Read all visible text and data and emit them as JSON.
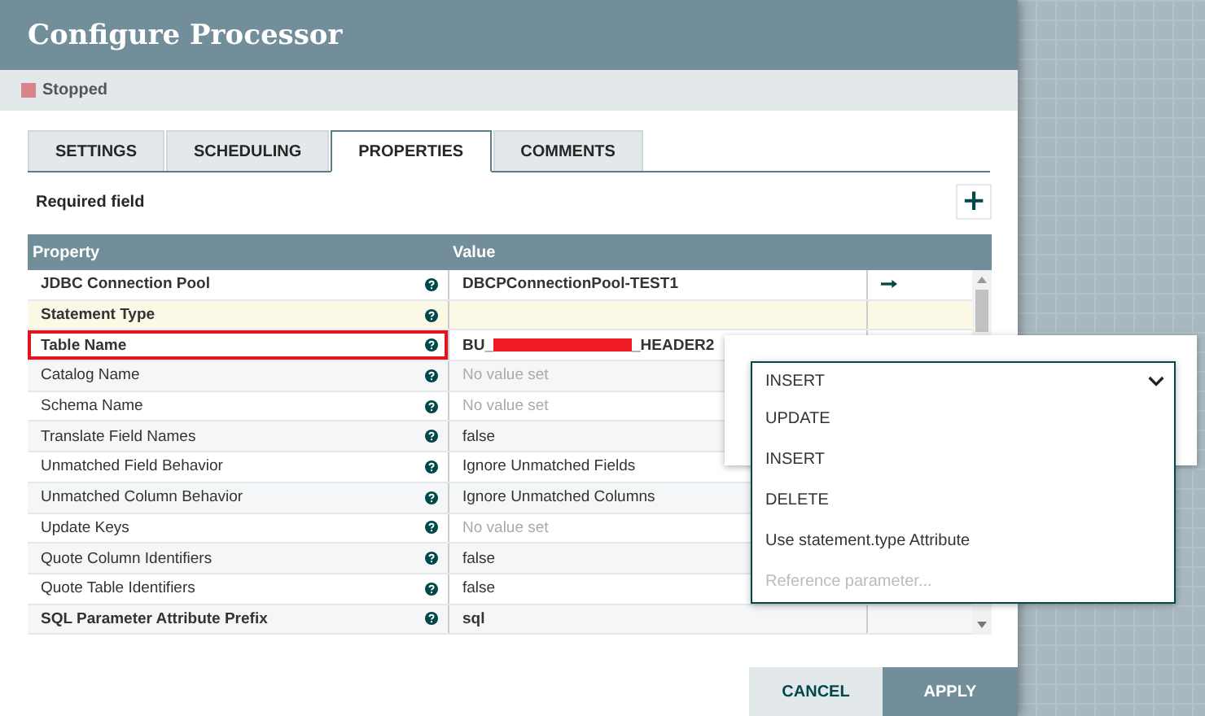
{
  "dialog": {
    "title": "Configure Processor",
    "status": {
      "label": "Stopped",
      "color": "#d9848c"
    }
  },
  "tabs": [
    {
      "label": "SETTINGS",
      "selected": false
    },
    {
      "label": "SCHEDULING",
      "selected": false
    },
    {
      "label": "PROPERTIES",
      "selected": true
    },
    {
      "label": "COMMENTS",
      "selected": false
    }
  ],
  "required_note": "Required field",
  "add_button": "+",
  "table": {
    "columns": [
      "Property",
      "Value"
    ],
    "rows": [
      {
        "property": "JDBC Connection Pool",
        "required": true,
        "selected": false,
        "highlighted": false,
        "value": "DBCPConnectionPool-TEST1",
        "link": true
      },
      {
        "property": "Statement Type",
        "required": true,
        "selected": true,
        "highlighted": false
      },
      {
        "property": "Table Name",
        "required": true,
        "selected": false,
        "highlighted": true,
        "value": "BU_",
        "value_suffix": "_HEADER2",
        "redacted": true
      },
      {
        "property": "Catalog Name",
        "required": false,
        "selected": false,
        "highlighted": false,
        "placeholder": "No value set"
      },
      {
        "property": "Schema Name",
        "required": false,
        "selected": false,
        "highlighted": false,
        "placeholder": "No value set"
      },
      {
        "property": "Translate Field Names",
        "required": false,
        "selected": false,
        "highlighted": false,
        "value": "false"
      },
      {
        "property": "Unmatched Field Behavior",
        "required": false,
        "selected": false,
        "highlighted": false,
        "value": "Ignore Unmatched Fields"
      },
      {
        "property": "Unmatched Column Behavior",
        "required": false,
        "selected": false,
        "highlighted": false,
        "value": "Ignore Unmatched Columns"
      },
      {
        "property": "Update Keys",
        "required": false,
        "selected": false,
        "highlighted": false,
        "placeholder": "No value set"
      },
      {
        "property": "Quote Column Identifiers",
        "required": false,
        "selected": false,
        "highlighted": false,
        "value": "false"
      },
      {
        "property": "Quote Table Identifiers",
        "required": false,
        "selected": false,
        "highlighted": false,
        "value": "false"
      },
      {
        "property": "SQL Parameter Attribute Prefix",
        "required": true,
        "selected": false,
        "highlighted": false,
        "value": "sql"
      }
    ]
  },
  "dropdown": {
    "value": "INSERT",
    "options": [
      {
        "label": "UPDATE",
        "disabled": false
      },
      {
        "label": "INSERT",
        "disabled": false
      },
      {
        "label": "DELETE",
        "disabled": false
      },
      {
        "label": "Use statement.type Attribute",
        "disabled": false
      },
      {
        "label": "Reference parameter...",
        "disabled": true
      }
    ]
  },
  "buttons": [
    {
      "label": "CANCEL",
      "kind": "secondary"
    },
    {
      "label": "APPLY",
      "kind": "primary"
    }
  ]
}
